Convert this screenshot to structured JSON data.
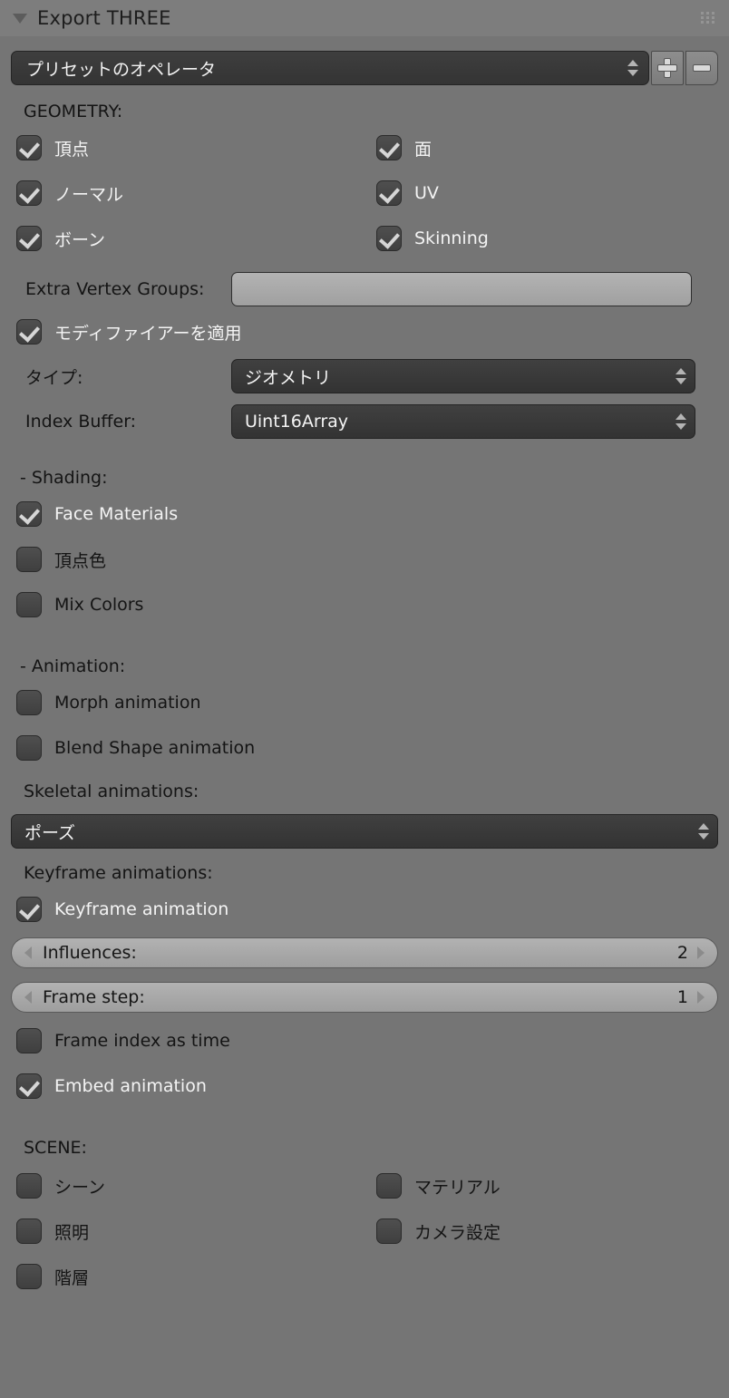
{
  "header": {
    "title": "Export THREE",
    "collapse_icon": "triangle-down-icon",
    "grip_icon": "grip-dots-icon"
  },
  "preset": {
    "value": "プリセットのオペレータ",
    "add_icon": "plus-icon",
    "remove_icon": "minus-icon",
    "spinner_icon": "up-down-arrows-icon"
  },
  "geometry": {
    "heading": "GEOMETRY:",
    "checkboxes_left": [
      {
        "label": "頂点",
        "checked": true
      },
      {
        "label": "ノーマル",
        "checked": true
      },
      {
        "label": "ボーン",
        "checked": true
      }
    ],
    "checkboxes_right": [
      {
        "label": "面",
        "checked": true
      },
      {
        "label": "UV",
        "checked": true
      },
      {
        "label": "Skinning",
        "checked": true
      }
    ],
    "extra_vertex_groups_label": "Extra Vertex Groups:",
    "extra_vertex_groups_value": "",
    "apply_modifiers": {
      "label": "モディファイアーを適用",
      "checked": true
    },
    "type_label": "タイプ:",
    "type_value": "ジオメトリ",
    "index_buffer_label": "Index Buffer:",
    "index_buffer_value": "Uint16Array"
  },
  "shading": {
    "heading": "- Shading:",
    "checkboxes": [
      {
        "label": "Face Materials",
        "checked": true
      },
      {
        "label": "頂点色",
        "checked": false
      },
      {
        "label": "Mix Colors",
        "checked": false
      }
    ]
  },
  "animation": {
    "heading": "- Animation:",
    "checkboxes": [
      {
        "label": "Morph animation",
        "checked": false
      },
      {
        "label": "Blend Shape animation",
        "checked": false
      }
    ],
    "skeletal_label": "Skeletal animations:",
    "skeletal_value": "ポーズ",
    "keyframe_label": "Keyframe animations:",
    "keyframe_checkbox": {
      "label": "Keyframe animation",
      "checked": true
    },
    "influences": {
      "label": "Influences:",
      "value": "2"
    },
    "frame_step": {
      "label": "Frame step:",
      "value": "1"
    },
    "frame_index_as_time": {
      "label": "Frame index as time",
      "checked": false
    },
    "embed_animation": {
      "label": "Embed animation",
      "checked": true
    }
  },
  "scene": {
    "heading": "SCENE:",
    "checkboxes_left": [
      {
        "label": "シーン",
        "checked": false
      },
      {
        "label": "照明",
        "checked": false
      },
      {
        "label": "階層",
        "checked": false
      }
    ],
    "checkboxes_right": [
      {
        "label": "マテリアル",
        "checked": false
      },
      {
        "label": "カメラ設定",
        "checked": false
      }
    ]
  },
  "colors": {
    "panel_bg": "#757575",
    "header_bg": "#7d7d7d",
    "dropdown_bg": "#3a3a3a",
    "slider_bg": "#a8a8a8",
    "checkbox_bg": "#474747",
    "text_dark": "#141414",
    "text_light": "#f4f4f4"
  }
}
